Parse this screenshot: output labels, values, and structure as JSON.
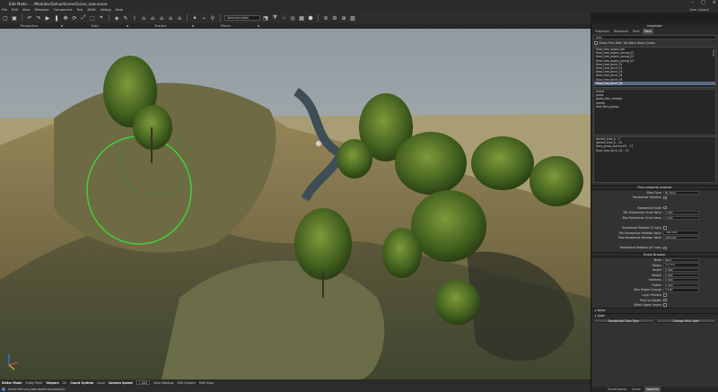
{
  "titlebar": {
    "title": "Edit Mode : .../Modules/Sahue/Scene/Scene_new.scene"
  },
  "menubar": {
    "items": [
      "File",
      "Edit",
      "View",
      "Windows",
      "Component",
      "Tool",
      "AEdit",
      "Debug",
      "Help"
    ],
    "user": "User Layout"
  },
  "toolbar": {
    "selection_field": "Selection(Idle)"
  },
  "viewport_tabs": [
    "Perspective",
    "Solid",
    "Shaded",
    "Effects"
  ],
  "status": {
    "editor_mode_label": "Editor Mode",
    "editor_mode_value": "Entity Paint",
    "helpers_label": "Helpers",
    "helpers_value": "On",
    "coord_label": "Coord System",
    "coord_value": "Local",
    "camera_speed_label": "Camera Speed",
    "camera_speed_value": "1.000",
    "view_settings": "View Settings",
    "grid_system": "Grid System",
    "path_snap": "Path Snap"
  },
  "log": {
    "message": "Scene file scn_new saved successfully."
  },
  "inspector": {
    "title": "Inspector",
    "tabs": [
      "Properties",
      "Baseband",
      "Paint",
      "Flora"
    ],
    "active_tab": "Flora",
    "search": "tree",
    "show_flora_label": "Show Flora With Too Many Body Quads",
    "flora_list": [
      "flora_tree_aspen_tall",
      "flora_tree_aspen_young_01",
      "flora_tree_aspen_young_02",
      "flora_tree_aspen_young_03",
      "flora_tree_birch_01",
      "flora_tree_birch_02",
      "flora_tree_birch_03",
      "flora_tree_birch_04",
      "flora_tree_birch_05",
      "flora_tree_birch_06"
    ],
    "flora_selected": 9,
    "layer_list": [
      "forest",
      "grass",
      "grass_dev_shadow",
      "weeds",
      "test_flora_group"
    ],
    "brush_list": [
      "decent_tree_a - 1",
      "decent_tree_b - 10",
      "flora_grass_autumn01 - 17",
      "flora_tree_birch_02 - 10"
    ],
    "property_browser": "Flora property browser",
    "props1": [
      {
        "label": "Filter Flora",
        "value": "No Filter",
        "type": "select"
      },
      {
        "label": "Randomize Variation",
        "type": "check"
      },
      {
        "label": "",
        "type": "space"
      },
      {
        "label": "Randomize Scale",
        "type": "check"
      },
      {
        "label": "Min Randomize Scale Value",
        "value": "1.000",
        "type": "field"
      },
      {
        "label": "Max Randomize Scale Value",
        "value": "1.000",
        "type": "field"
      },
      {
        "label": "",
        "type": "space"
      },
      {
        "label": "Randomize Rotation (Z axis)",
        "type": "check"
      },
      {
        "label": "Min Randomize Rotation Value",
        "value": "-180.000",
        "type": "field"
      },
      {
        "label": "Max Randomize Rotation Value",
        "value": "180.000",
        "type": "field"
      },
      {
        "label": "",
        "type": "space"
      },
      {
        "label": "Randomize Rotation (X-Y axis)",
        "type": "check"
      }
    ],
    "brush_header": "Brush Browser",
    "props2": [
      {
        "label": "Mode",
        "value": "Paint",
        "type": "select"
      },
      {
        "label": "Radius",
        "value": "14.776",
        "type": "field"
      },
      {
        "label": "Height",
        "value": "0.300",
        "type": "field"
      },
      {
        "label": "Weight",
        "value": "0.500",
        "type": "field"
      },
      {
        "label": "Hardness",
        "value": "0.300",
        "type": "field"
      },
      {
        "label": "Flatten",
        "value": "0.300",
        "type": "field"
      },
      {
        "label": "Max Height Change",
        "value": "0.000",
        "type": "field"
      },
      {
        "label": "Layer Preview",
        "type": "check"
      },
      {
        "label": "Paint on Bodies",
        "type": "check"
      },
      {
        "label": "Affect Upper Layers",
        "type": "check"
      }
    ],
    "folds": [
      "Noise",
      "Splat"
    ],
    "buttons": [
      "Randomize Flora Type",
      "Change Flora Type"
    ],
    "bottom_tabs": [
      "SceneOptions",
      "Scene",
      "Inspector"
    ]
  }
}
